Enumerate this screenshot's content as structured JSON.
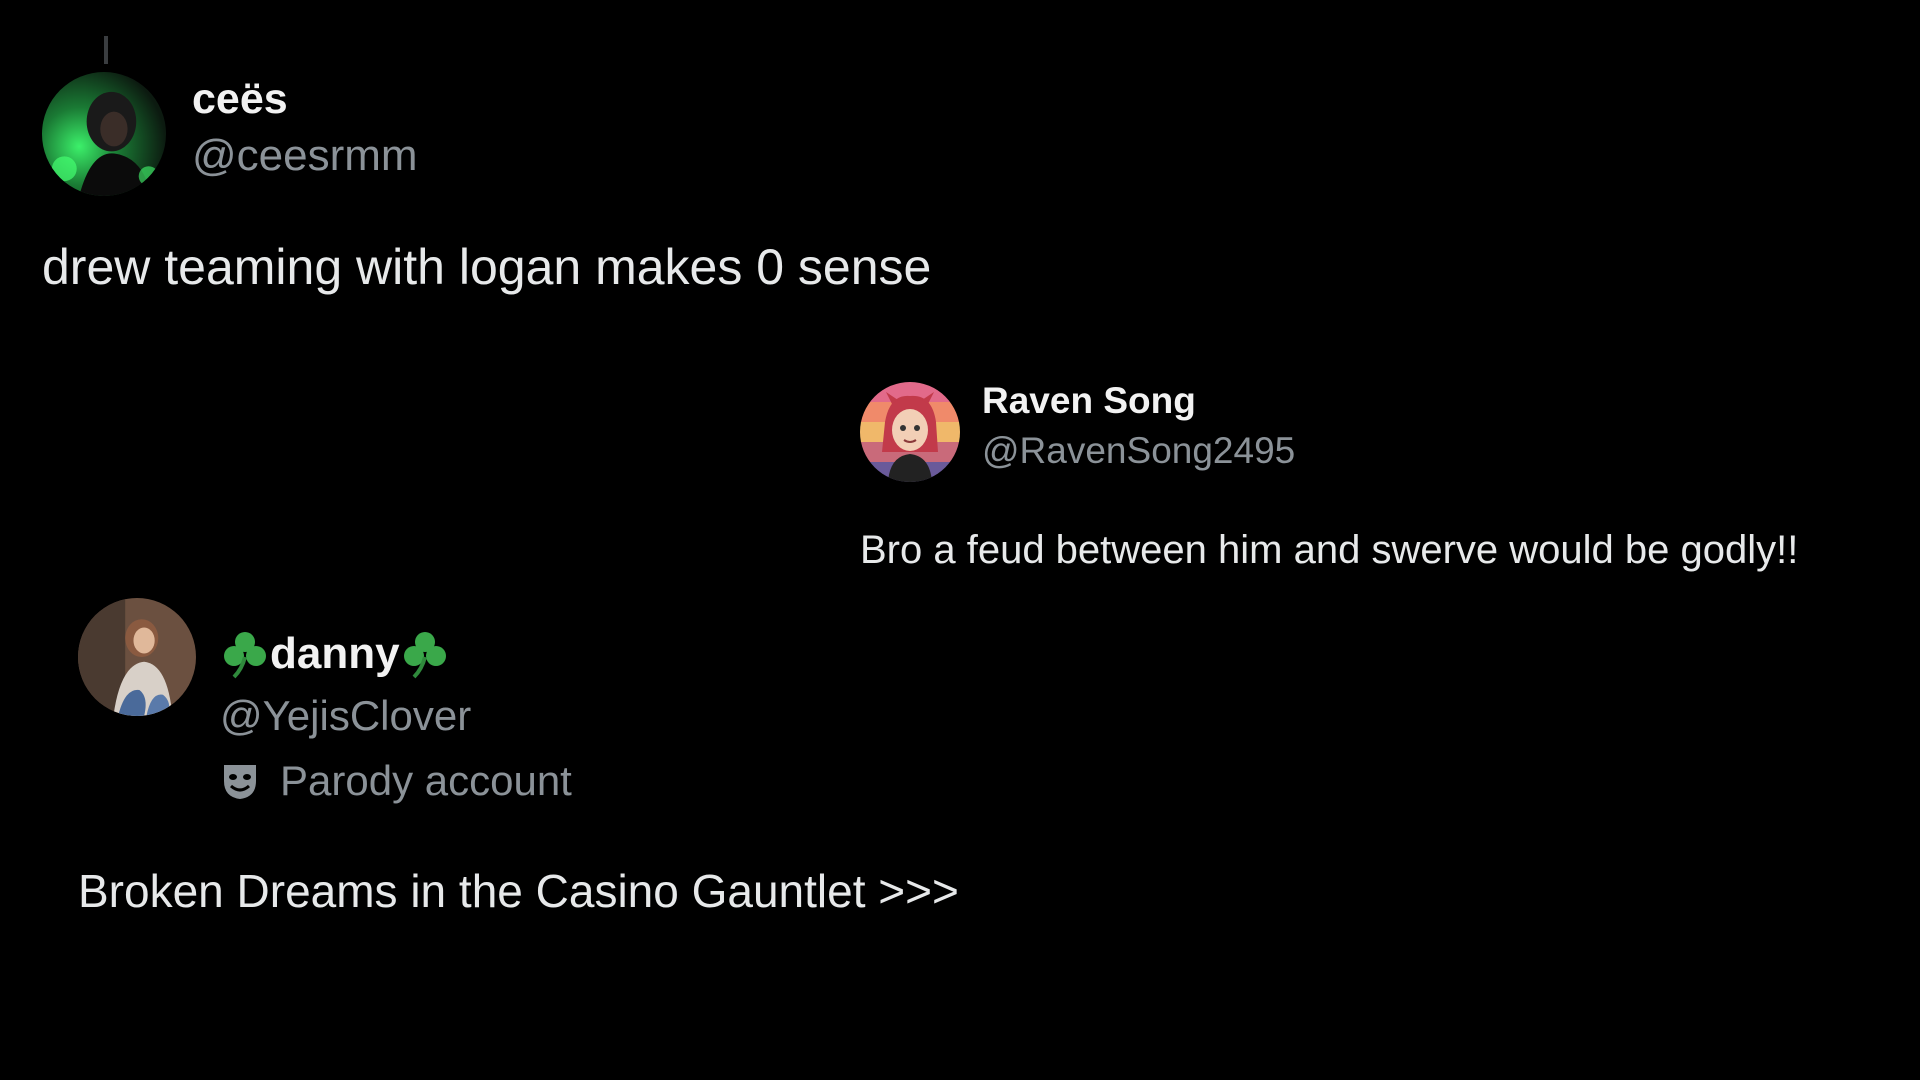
{
  "posts": [
    {
      "display_name": "ceës",
      "handle": "@ceesrmm",
      "text": "drew teaming with logan makes 0 sense",
      "avatar_icon": "user-avatar-photo"
    },
    {
      "display_name": "Raven Song",
      "handle": "@RavenSong2495",
      "text": "Bro a feud between him and swerve would be godly!!",
      "avatar_icon": "user-avatar-illustration"
    },
    {
      "display_name": "danny",
      "name_decoration_icon": "shamrock-icon",
      "handle": "@YejisClover",
      "badge_label": "Parody account",
      "badge_icon": "theater-mask-icon",
      "text": "Broken Dreams in the Casino Gauntlet >>>",
      "avatar_icon": "user-avatar-photo"
    }
  ],
  "colors": {
    "background": "#000000",
    "text_primary": "#e7e9ea",
    "text_secondary": "#8b9298",
    "shamrock": "#3aa84a",
    "avatar_glow": "#2fe05a"
  }
}
